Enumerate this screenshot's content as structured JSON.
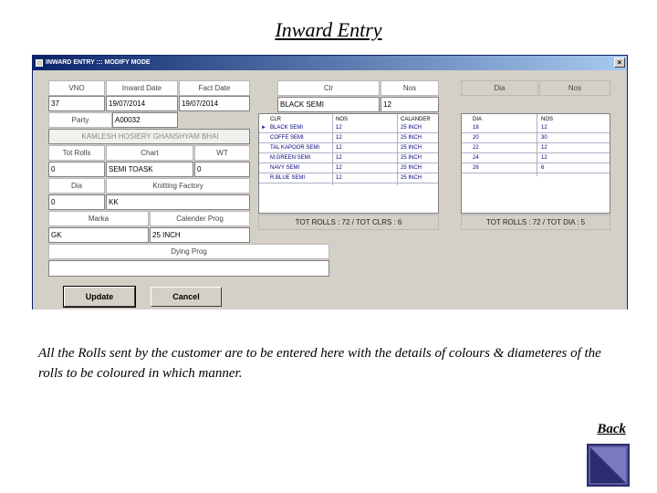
{
  "slide": {
    "title": "Inward Entry",
    "description": "All the Rolls sent by the customer are to be entered here with the details of colours & diameteres of the rolls to be coloured in which manner.",
    "back_label": "Back"
  },
  "window": {
    "title": "INWARD ENTRY  :::  MODIFY MODE",
    "close_glyph": "×"
  },
  "form": {
    "labels": {
      "vno": "VNO",
      "inward_date": "Inward Date",
      "fact_date": "Fact Date",
      "party": "Party",
      "tot_rolls": "Tot Rolls",
      "chart": "Chart",
      "wt": "WT",
      "dia": "Dia",
      "knitting_factory": "Knitting Factory",
      "marka": "Marka",
      "calender_prog": "Calender Prog",
      "dying_prog": "Dying Prog"
    },
    "values": {
      "vno": "37",
      "inward_date": "19/07/2014",
      "fact_date": "19/07/2014",
      "party_code": "A00032",
      "party_name": "KAMLESH HOSIERY GHANSHYAM BHAI",
      "tot_rolls": "0",
      "chart": "SEMI TOASK",
      "wt": "0",
      "dia": "0",
      "knitting_factory": "KK",
      "marka": "GK",
      "calender_prog": "25 INCH",
      "dying_prog": ""
    }
  },
  "colour_grid": {
    "entry_headers": [
      "Clr",
      "Nos"
    ],
    "entry_values": [
      "BLACK SEMI",
      "12"
    ],
    "columns": [
      "CLR",
      "NOS",
      "CALANDER"
    ],
    "rows": [
      [
        "BLACK SEMI",
        "12",
        "25 INCH"
      ],
      [
        "COFFE SEMI",
        "12",
        "25 INCH"
      ],
      [
        "TAL KAPOOR SEMI",
        "12",
        "25 INCH"
      ],
      [
        "M.GREEN SEMI",
        "12",
        "25 INCH"
      ],
      [
        "NAVY SEMI",
        "12",
        "25 INCH"
      ],
      [
        "R.BLUE SEMI",
        "12",
        "25 INCH"
      ]
    ],
    "totals": "TOT ROLLS : 72 / TOT CLRS : 6"
  },
  "dia_grid": {
    "entry_headers": [
      "Dia",
      "Nos"
    ],
    "columns": [
      "DIA",
      "NOS"
    ],
    "rows": [
      [
        "18",
        "12"
      ],
      [
        "20",
        "30"
      ],
      [
        "22",
        "12"
      ],
      [
        "24",
        "12"
      ],
      [
        "26",
        "6"
      ]
    ],
    "totals": "TOT ROLLS : 72 / TOT DIA : 5"
  },
  "buttons": {
    "update": "Update",
    "cancel": "Cancel"
  }
}
